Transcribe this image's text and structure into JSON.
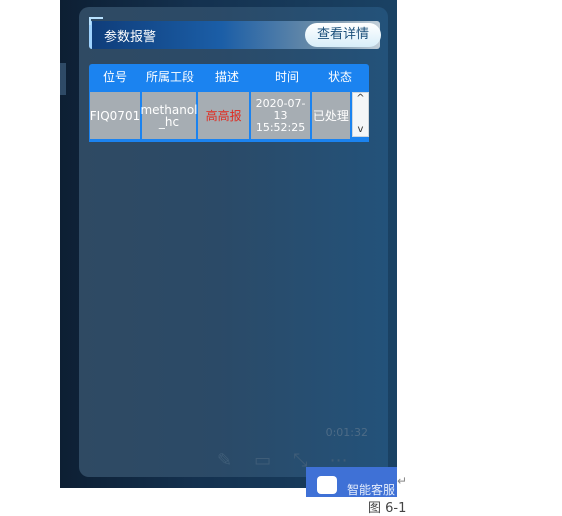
{
  "panel": {
    "title": "参数报警",
    "detail_button": "查看详情"
  },
  "table": {
    "headers": [
      "位号",
      "所属工段",
      "描述",
      "时间",
      "状态"
    ],
    "rows": [
      {
        "tag": "FIQ0701",
        "section": "methanol\n_hc",
        "description": "高高报",
        "time": "2020-07-13\n15:52:25",
        "status": "已处理"
      }
    ],
    "scroll_up": "^",
    "scroll_down": "v"
  },
  "player": {
    "timer": "0:01:32",
    "icons": [
      "pencil-icon",
      "subtitle-icon",
      "collapse-icon",
      "more-icon"
    ]
  },
  "assistant": {
    "label": "智能客服"
  },
  "caption": "图 6-1",
  "colors": {
    "table_header": "#1b83f0",
    "cell_bg": "#a6adb3",
    "alarm_text": "#e02a1f"
  }
}
